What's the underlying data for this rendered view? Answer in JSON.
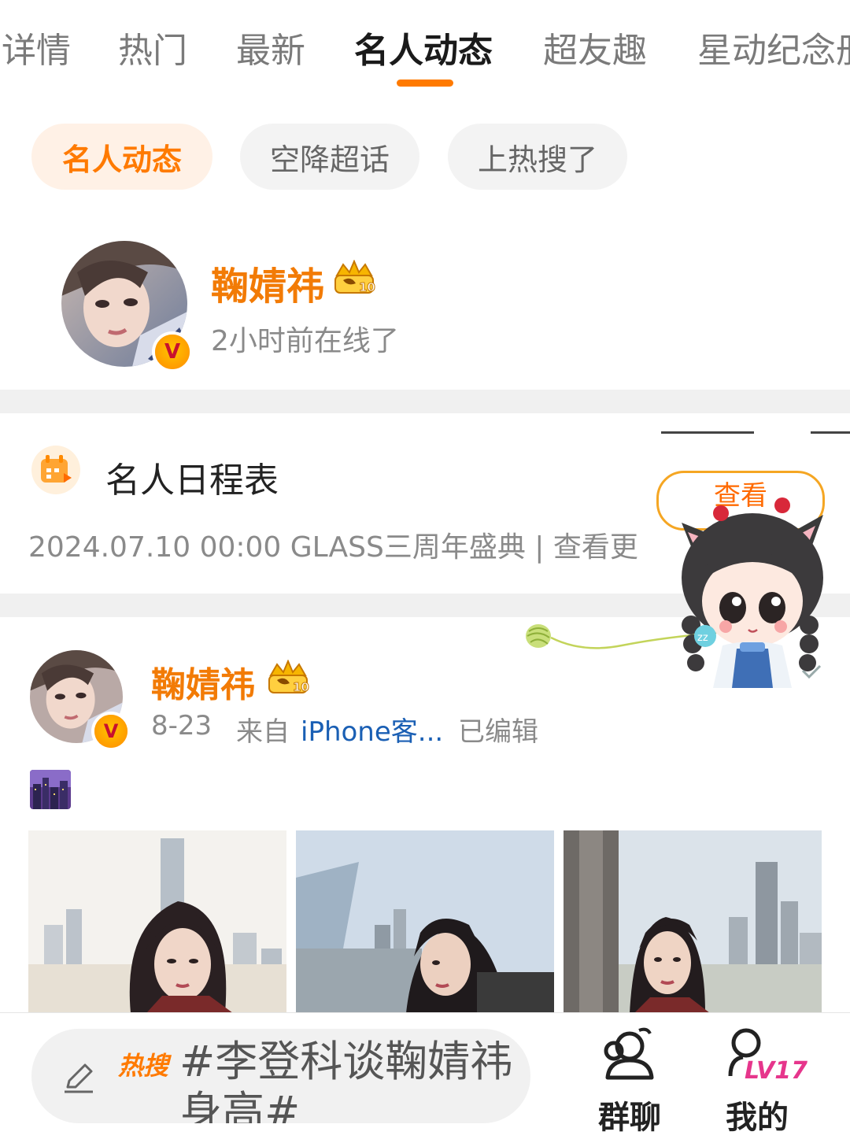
{
  "tabs": [
    {
      "label": "详情",
      "active": false
    },
    {
      "label": "热门",
      "active": false
    },
    {
      "label": "最新",
      "active": false
    },
    {
      "label": "名人动态",
      "active": true
    },
    {
      "label": "超友趣",
      "active": false
    },
    {
      "label": "星动纪念册",
      "active": false
    }
  ],
  "chips": [
    {
      "label": "名人动态",
      "active": true
    },
    {
      "label": "空降超话",
      "active": false
    },
    {
      "label": "上热搜了",
      "active": false
    }
  ],
  "profile": {
    "name": "鞠婧祎",
    "status": "2小时前在线了",
    "badge_icon": "crown-level-10-icon",
    "verified_icon": "verified-v-icon"
  },
  "schedule": {
    "title": "名人日程表",
    "detail": "2024.07.10 00:00 GLASS三周年盛典 |  查看更",
    "view_label": "查看"
  },
  "post": {
    "author": "鞠婧祎",
    "date": "8-23",
    "from_prefix": "来自",
    "source": "iPhone客...",
    "edited": "已编辑",
    "emoji_icon": "city-night-icon",
    "photos": [
      "photo-1",
      "photo-2",
      "photo-3"
    ]
  },
  "bottom": {
    "hot_tag": "热搜",
    "composer_text": "#李登科谈鞠婧祎身高#",
    "nav_group_label": "群聊",
    "nav_mine_label": "我的",
    "level_badge": "LV17"
  },
  "colors": {
    "accent": "#ff7a00",
    "name_orange": "#f27b06",
    "link_blue": "#1a5fb4"
  }
}
